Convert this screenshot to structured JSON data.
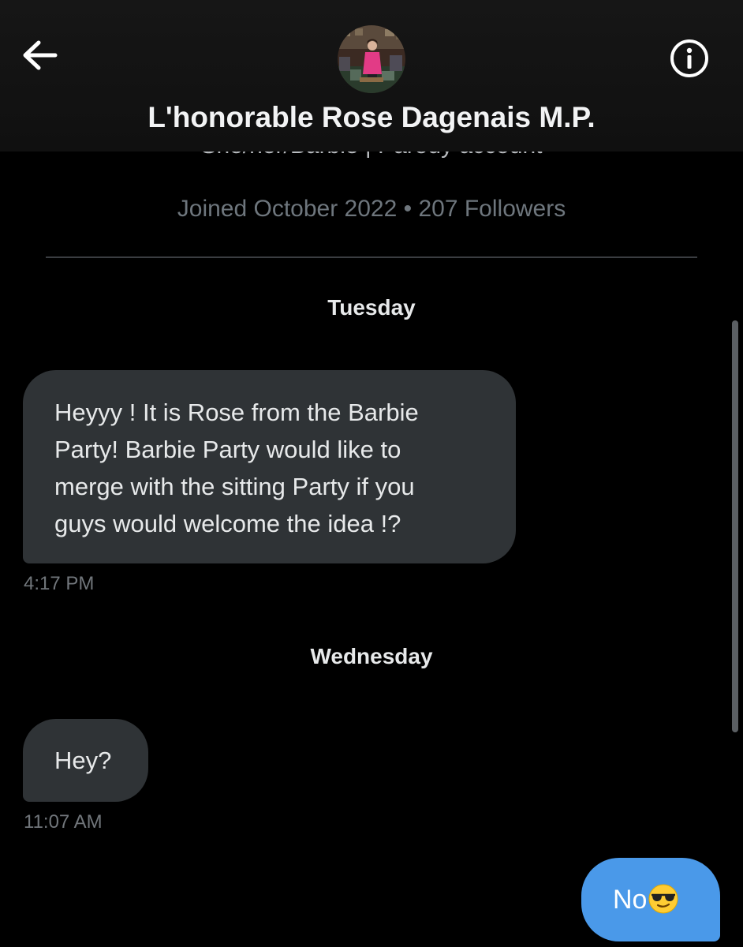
{
  "header": {
    "title": "L'honorable Rose Dagenais M.P.",
    "back_icon": "arrow-left-icon",
    "info_icon": "info-circle-icon"
  },
  "profile": {
    "bio": "She/her/Barbie | Parody account",
    "meta": "Joined October 2022 • 207 Followers"
  },
  "conversation": [
    {
      "day": "Tuesday",
      "messages": [
        {
          "direction": "incoming",
          "lines": [
            "Heyyy ! It is Rose from the Barbie",
            "Party! Barbie Party would like to",
            "merge with the sitting Party if you",
            "guys would welcome the idea !?"
          ],
          "time": "4:17 PM"
        }
      ]
    },
    {
      "day": "Wednesday",
      "messages": [
        {
          "direction": "incoming",
          "lines": [
            "Hey?"
          ],
          "time": "11:07 AM"
        },
        {
          "direction": "outgoing",
          "text": "No",
          "emoji": "smiling-face-with-sunglasses"
        }
      ]
    }
  ],
  "colors": {
    "background": "#000000",
    "header": "#141414",
    "incoming_bubble": "#2f3336",
    "outgoing_bubble": "#4a99e9",
    "secondary_text": "#71767b"
  }
}
